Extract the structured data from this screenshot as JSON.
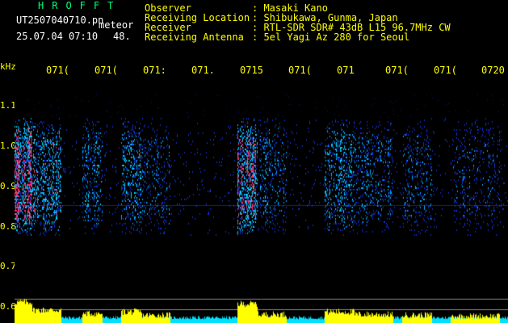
{
  "header": {
    "logo": "HROFFT",
    "filename": "UT2507040710.pn",
    "file_type": "meteor",
    "datetime": "25.07.04 07:10",
    "value": "48.",
    "info": [
      {
        "label": "Observer",
        "value": ": Masaki Kano"
      },
      {
        "label": "Receiving Location",
        "value": ": Shibukawa, Gunma, Japan"
      },
      {
        "label": "Receiver",
        "value": ": RTL-SDR SDR# 43dB L15 96.7MHz CW"
      },
      {
        "label": "Receiving Antenna",
        "value": ": 5el Yagi Az 280 for Seoul"
      }
    ]
  },
  "time_axis": {
    "labels": [
      "071(",
      "071(",
      "071:",
      "071.",
      "0715",
      "071(",
      "071",
      "071(",
      "071(",
      "0720"
    ]
  },
  "freq_axis": {
    "unit": "kHz",
    "labels": [
      "1.1",
      "1.0",
      "0.9",
      "0.8",
      "0.7",
      "0.6"
    ]
  },
  "colors": {
    "background": "#000000",
    "text_header_right": "#ffff00",
    "logo": "#00ff7a",
    "spectrum_low": "#1030d0",
    "spectrum_mid": "#00e0ff",
    "spectrum_high": "#ff2070",
    "histogram_yellow": "#ffff00",
    "histogram_cyan": "#00e0ff"
  },
  "spectrogram": {
    "bursts": [
      {
        "start_minute": 0.0,
        "end_minute": 0.35,
        "intensity": 1.0
      },
      {
        "start_minute": 0.35,
        "end_minute": 0.95,
        "intensity": 0.55
      },
      {
        "start_minute": 1.4,
        "end_minute": 1.8,
        "intensity": 0.35
      },
      {
        "start_minute": 2.2,
        "end_minute": 2.6,
        "intensity": 0.45
      },
      {
        "start_minute": 2.6,
        "end_minute": 3.2,
        "intensity": 0.25
      },
      {
        "start_minute": 4.6,
        "end_minute": 5.0,
        "intensity": 0.9
      },
      {
        "start_minute": 5.0,
        "end_minute": 5.6,
        "intensity": 0.3
      },
      {
        "start_minute": 6.4,
        "end_minute": 7.0,
        "intensity": 0.45
      },
      {
        "start_minute": 7.0,
        "end_minute": 7.8,
        "intensity": 0.3
      },
      {
        "start_minute": 8.0,
        "end_minute": 8.6,
        "intensity": 0.25
      },
      {
        "start_minute": 9.0,
        "end_minute": 10.0,
        "intensity": 0.2
      }
    ]
  }
}
